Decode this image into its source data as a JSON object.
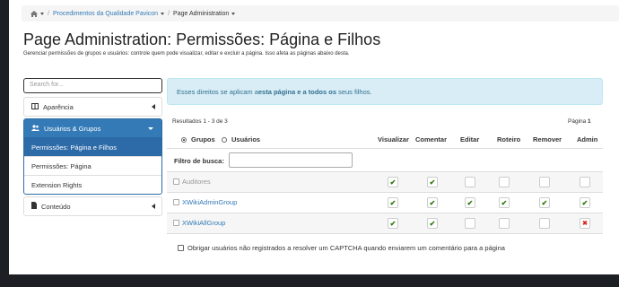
{
  "breadcrumb": {
    "items": [
      "Procedimentos da Qualidade Pavicon",
      "Page Administration"
    ]
  },
  "page": {
    "title": "Page Administration: Permissões: Página e Filhos",
    "description": "Gerenciar permissões de grupos e usuários: controle quem pode visualizar, editar e excluir a página. Isso afeta as páginas abaixo desta."
  },
  "sidebar": {
    "search_placeholder": "Search for...",
    "appearance": "Aparência",
    "users_groups": "Usuários & Grupos",
    "sub_items": [
      "Permissões: Página e Filhos",
      "Permissões: Página",
      "Extension Rights"
    ],
    "content": "Conteúdo"
  },
  "alert": {
    "prefix": "Esses direitos se aplicam a ",
    "bold1": "esta página",
    "middle": " e ",
    "bold2": "a todos os",
    "suffix": " seus filhos."
  },
  "table": {
    "results": "Resultados 1 - 3 de 3",
    "page_label": "Página ",
    "page_num": "1",
    "col_groups": "Grupos",
    "col_users": "Usuários",
    "columns": [
      "Visualizar",
      "Comentar",
      "Editar",
      "Roteiro",
      "Remover",
      "Admin"
    ],
    "filter_label": "Filtro de busca:",
    "rows": [
      {
        "name": "Auditores",
        "rights": [
          "yes",
          "yes",
          "",
          "",
          "",
          ""
        ]
      },
      {
        "name": "XWikiAdminGroup",
        "rights": [
          "yes",
          "yes",
          "yes",
          "yes",
          "yes",
          "yes"
        ]
      },
      {
        "name": "XWikiAllGroup",
        "rights": [
          "yes",
          "yes",
          "",
          "",
          "",
          "no"
        ]
      }
    ]
  },
  "captcha": {
    "label": "Obrigar usuários não registrados a resolver um CAPTCHA quando enviarem um comentário para a página"
  },
  "colors": {
    "accent": "#337ab7",
    "alert_bg": "#d9edf7",
    "check": "#2b7a0b",
    "deny": "#dd2222"
  }
}
